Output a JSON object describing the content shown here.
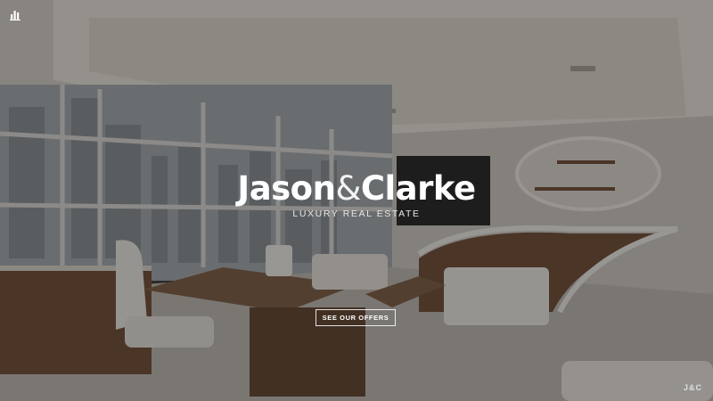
{
  "hero": {
    "background_description_icon": "office-photo",
    "brand": {
      "name_first": "Jason",
      "ampersand": "&",
      "name_second": "Clarke",
      "tagline": "LUXURY REAL ESTATE"
    },
    "cta_label": "SEE OUR OFFERS",
    "footer_mark": "J&C",
    "corner_icon": "bar-chart-icon"
  },
  "colors": {
    "overlay": "#141414",
    "text": "#ffffff",
    "wall": "#bcb7b0",
    "wood": "#6b4a32",
    "ceiling": "#d9d4cc"
  }
}
